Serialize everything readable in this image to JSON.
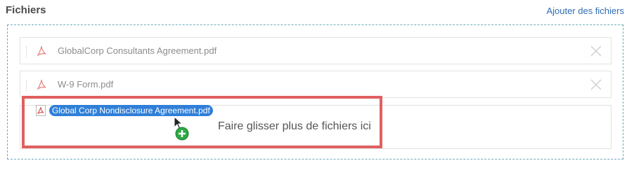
{
  "header": {
    "title": "Fichiers",
    "add_files_link": "Ajouter des fichiers"
  },
  "files": [
    {
      "name": "GlobalCorp Consultants Agreement.pdf",
      "icon": "pdf-icon"
    },
    {
      "name": "W-9 Form.pdf",
      "icon": "pdf-icon"
    }
  ],
  "dragging": {
    "file_name": "Global Corp Nondisclosure Agreement.pdf",
    "icon": "pdf-icon"
  },
  "drop_zone": {
    "hint": "Faire glisser plus de fichiers ici"
  },
  "colors": {
    "accent": "#2d6db5",
    "pill": "#2f7fd8",
    "highlight": "#e06060",
    "plus": "#2ea844",
    "pdf": "#d9534f"
  }
}
